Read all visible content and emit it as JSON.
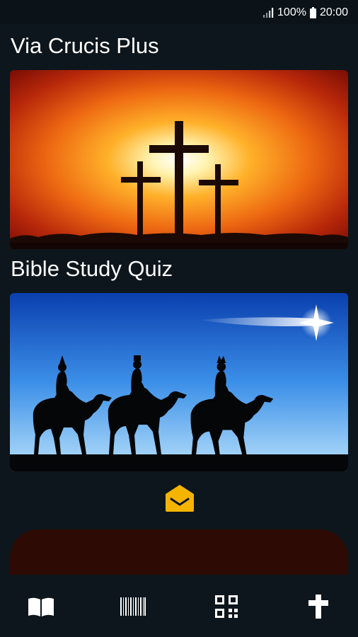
{
  "status_bar": {
    "battery_percent": "100%",
    "time": "20:00"
  },
  "sections": [
    {
      "title": "Via Crucis Plus",
      "image": "three-crosses-sunset"
    },
    {
      "title": "Bible Study Quiz",
      "image": "three-wise-men-camels-star"
    }
  ],
  "mail_icon": "envelope-open-icon",
  "bottom_nav": [
    {
      "icon": "book-icon"
    },
    {
      "icon": "barcode-icon"
    },
    {
      "icon": "qr-code-icon"
    },
    {
      "icon": "cross-icon"
    }
  ],
  "colors": {
    "background": "#0d161c",
    "accent_yellow": "#f5b400",
    "panel_brown": "#2d0b04"
  }
}
